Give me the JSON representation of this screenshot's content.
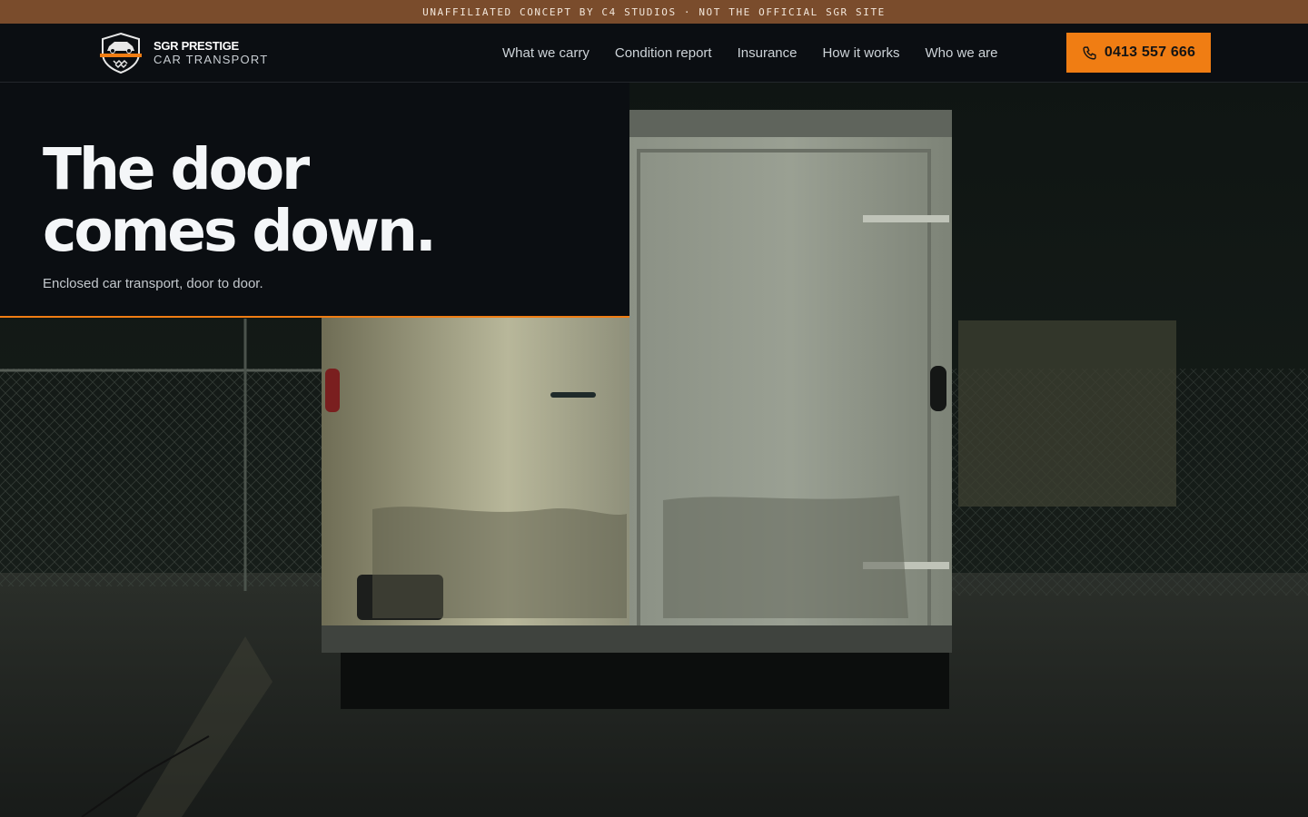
{
  "announcement": "UNAFFILIATED CONCEPT BY C4 STUDIOS · NOT THE OFFICIAL SGR SITE",
  "brand": {
    "name_line1": "SGR PRESTIGE",
    "name_line2": "CAR TRANSPORT",
    "logo_icon": "shield-car-logo"
  },
  "nav": {
    "links": [
      "What we carry",
      "Condition report",
      "Insurance",
      "How it works",
      "Who we are"
    ]
  },
  "cta": {
    "icon": "phone-icon",
    "label": "0413 557 666"
  },
  "hero": {
    "headline_line1": "The door",
    "headline_line2": "comes down.",
    "subheadline": "Enclosed car transport, door to door.",
    "image": "enclosed-trailer-night-photo"
  },
  "colors": {
    "accent": "#f07d13",
    "announcement_bg": "#7a4c2c",
    "nav_bg": "#0b0e12"
  }
}
